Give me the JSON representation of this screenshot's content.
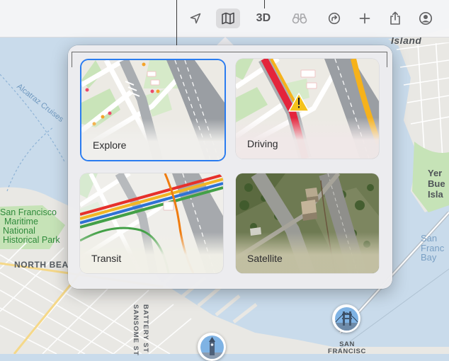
{
  "toolbar": {
    "three_d_label": "3D",
    "buttons": [
      {
        "name": "location-arrow-icon"
      },
      {
        "name": "map-mode-icon",
        "active": true
      },
      {
        "name": "3d-button"
      },
      {
        "name": "binoculars-icon"
      },
      {
        "name": "directions-icon"
      },
      {
        "name": "plus-icon"
      },
      {
        "name": "share-icon"
      },
      {
        "name": "account-icon"
      }
    ]
  },
  "popover": {
    "map_styles": [
      {
        "id": "explore",
        "label": "Explore",
        "selected": true
      },
      {
        "id": "driving",
        "label": "Driving",
        "selected": false
      },
      {
        "id": "transit",
        "label": "Transit",
        "selected": false
      },
      {
        "id": "satellite",
        "label": "Satellite",
        "selected": false
      }
    ]
  },
  "map": {
    "labels": {
      "island": "Island",
      "alcatraz": "Alcatraz Cruises",
      "park_lines": [
        "San Francisco",
        "Maritime",
        "National",
        "Historical Park"
      ],
      "district": "NORTH BEA",
      "battery": "BATTERY ST",
      "sansome": "SANSOME ST",
      "yerba": [
        "Yer",
        "Bue",
        "Isla"
      ],
      "sf_bay": [
        "San",
        "Franc",
        "Bay"
      ],
      "sf_pin": [
        "SAN",
        "FRANCISC"
      ]
    }
  },
  "colors": {
    "accent": "#2a7cf0",
    "water": "#c9dbeb",
    "land": "#e9e8e4",
    "park": "#c6e3b7"
  }
}
